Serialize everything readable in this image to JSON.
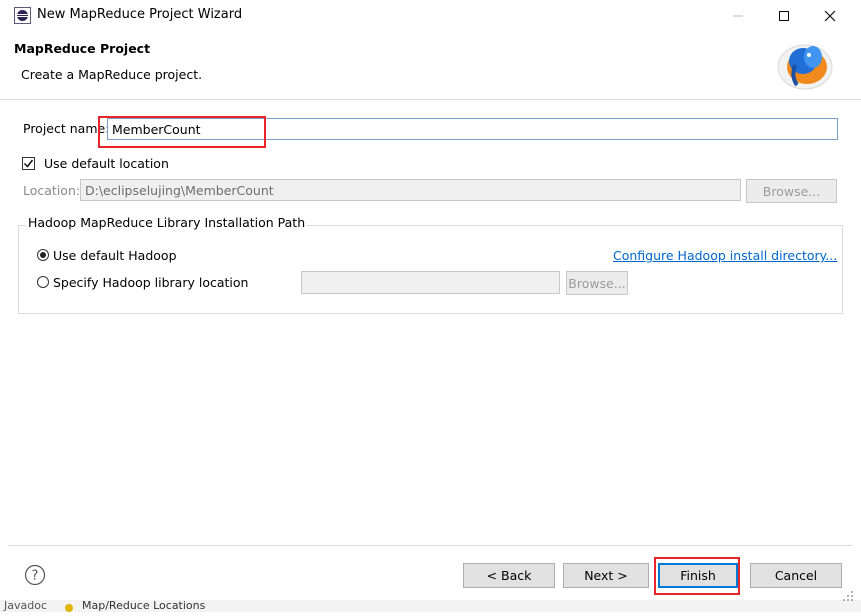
{
  "window": {
    "title": "New MapReduce Project Wizard"
  },
  "header": {
    "title": "MapReduce Project",
    "description": "Create a MapReduce project."
  },
  "form": {
    "project_name_label": "Project name:",
    "project_name_value": "MemberCount",
    "use_default_location_label": "Use default location",
    "use_default_location_checked": true,
    "location_label": "Location:",
    "location_value": "D:\\eclipselujing\\MemberCount",
    "browse_label": "Browse..."
  },
  "hadoop_group": {
    "title": "Hadoop MapReduce Library Installation Path",
    "use_default_label": "Use default Hadoop",
    "configure_link": "Configure Hadoop install directory...",
    "specify_label": "Specify Hadoop library location",
    "specify_value": "",
    "browse_label": "Browse..."
  },
  "footer": {
    "back_label": "< Back",
    "next_label": "Next >",
    "finish_label": "Finish",
    "cancel_label": "Cancel"
  },
  "bottom_strip": {
    "left_text": "Javadoc",
    "tab_text": "Map/Reduce Locations"
  },
  "colors": {
    "highlight_box": "#e8262a",
    "link": "#0066cc"
  },
  "icons": {
    "app": "eclipse-icon",
    "logo": "hadoop-elephant-icon",
    "help": "help-icon"
  }
}
